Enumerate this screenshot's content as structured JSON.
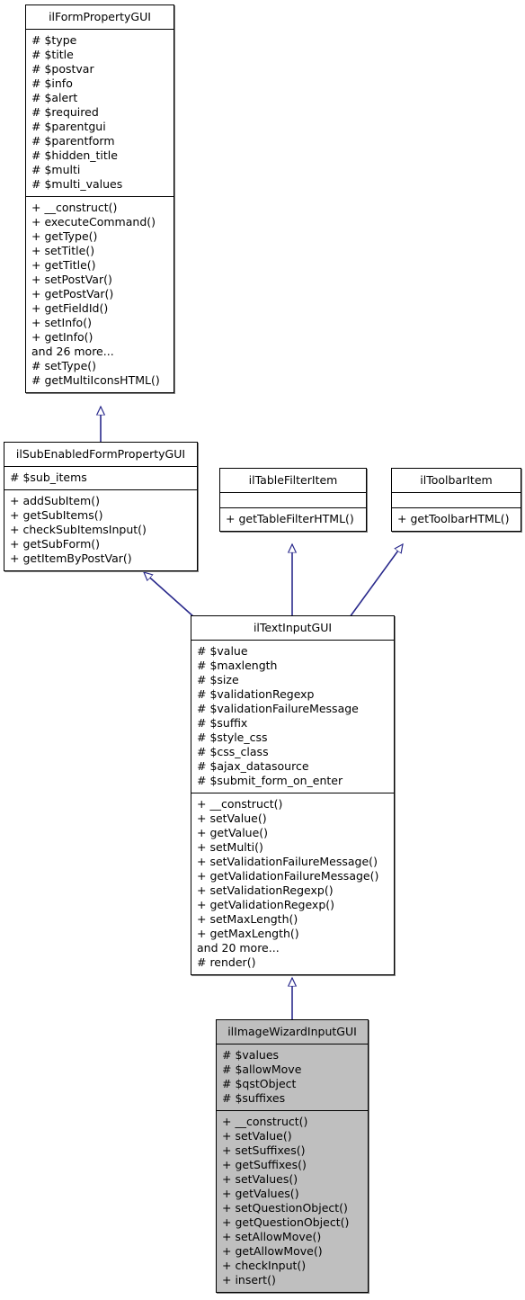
{
  "diagram": {
    "type": "uml-class-inheritance",
    "line_color": "#2a2a8c",
    "highlight_fill": "#bfbfbf",
    "box_fill": "#ffffff",
    "border_color": "#000000"
  },
  "classes": [
    {
      "id": "ilFormPropertyGUI",
      "name": "ilFormPropertyGUI",
      "highlighted": false,
      "attributes": [
        "# $type",
        "# $title",
        "# $postvar",
        "# $info",
        "# $alert",
        "# $required",
        "# $parentgui",
        "# $parentform",
        "# $hidden_title",
        "# $multi",
        "# $multi_values"
      ],
      "methods": [
        "+ __construct()",
        "+ executeCommand()",
        "+ getType()",
        "+ setTitle()",
        "+ getTitle()",
        "+ setPostVar()",
        "+ getPostVar()",
        "+ getFieldId()",
        "+ setInfo()",
        "+ getInfo()",
        "and 26 more...",
        "# setType()",
        "# getMultiIconsHTML()"
      ]
    },
    {
      "id": "ilSubEnabledFormPropertyGUI",
      "name": "ilSubEnabledFormPropertyGUI",
      "highlighted": false,
      "attributes": [
        "# $sub_items"
      ],
      "methods": [
        "+ addSubItem()",
        "+ getSubItems()",
        "+ checkSubItemsInput()",
        "+ getSubForm()",
        "+ getItemByPostVar()"
      ]
    },
    {
      "id": "ilTableFilterItem",
      "name": "ilTableFilterItem",
      "highlighted": false,
      "attributes": [],
      "methods": [
        "+ getTableFilterHTML()"
      ]
    },
    {
      "id": "ilToolbarItem",
      "name": "ilToolbarItem",
      "highlighted": false,
      "attributes": [],
      "methods": [
        "+ getToolbarHTML()"
      ]
    },
    {
      "id": "ilTextInputGUI",
      "name": "ilTextInputGUI",
      "highlighted": false,
      "attributes": [
        "# $value",
        "# $maxlength",
        "# $size",
        "# $validationRegexp",
        "# $validationFailureMessage",
        "# $suffix",
        "# $style_css",
        "# $css_class",
        "# $ajax_datasource",
        "# $submit_form_on_enter"
      ],
      "methods": [
        "+ __construct()",
        "+ setValue()",
        "+ getValue()",
        "+ setMulti()",
        "+ setValidationFailureMessage()",
        "+ getValidationFailureMessage()",
        "+ setValidationRegexp()",
        "+ getValidationRegexp()",
        "+ setMaxLength()",
        "+ getMaxLength()",
        "and 20 more...",
        "# render()"
      ]
    },
    {
      "id": "ilImageWizardInputGUI",
      "name": "ilImageWizardInputGUI",
      "highlighted": true,
      "attributes": [
        "# $values",
        "# $allowMove",
        "# $qstObject",
        "# $suffixes"
      ],
      "methods": [
        "+ __construct()",
        "+ setValue()",
        "+ setSuffixes()",
        "+ getSuffixes()",
        "+ setValues()",
        "+ getValues()",
        "+ setQuestionObject()",
        "+ getQuestionObject()",
        "+ setAllowMove()",
        "+ getAllowMove()",
        "+ checkInput()",
        "+ insert()"
      ]
    }
  ],
  "relations": [
    {
      "from": "ilSubEnabledFormPropertyGUI",
      "to": "ilFormPropertyGUI",
      "kind": "generalization"
    },
    {
      "from": "ilTextInputGUI",
      "to": "ilSubEnabledFormPropertyGUI",
      "kind": "generalization"
    },
    {
      "from": "ilTextInputGUI",
      "to": "ilTableFilterItem",
      "kind": "generalization"
    },
    {
      "from": "ilTextInputGUI",
      "to": "ilToolbarItem",
      "kind": "generalization"
    },
    {
      "from": "ilImageWizardInputGUI",
      "to": "ilTextInputGUI",
      "kind": "generalization"
    }
  ]
}
